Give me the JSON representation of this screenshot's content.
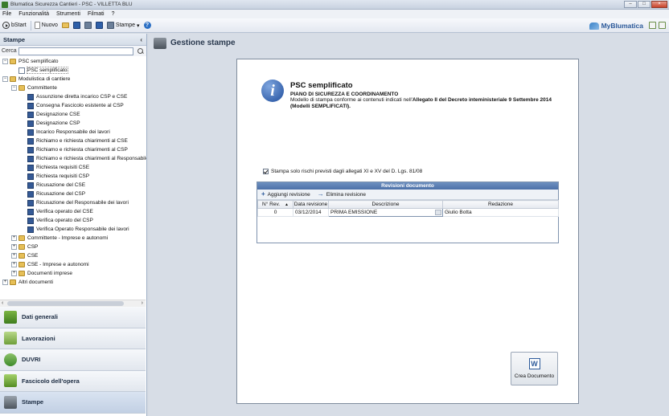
{
  "window": {
    "title": "Blumatica Sicurezza Cantieri - PSC - VILLETTA BLU",
    "minimize": "–",
    "maximize": "□",
    "close": "×"
  },
  "menu": [
    "File",
    "Funzionalità",
    "Strumenti",
    "Filmati",
    "?"
  ],
  "toolbar": {
    "start_label": "bStart",
    "new_label": "Nuovo",
    "print_label": "Stampe",
    "print_arrow": "▾",
    "help_glyph": "?",
    "brand": "MyBlumatica"
  },
  "left_panel": {
    "title": "Stampe",
    "collapse_glyph": "‹",
    "search_label": "Cerca",
    "search_value": "",
    "tree": [
      {
        "label": "PSC semplificato",
        "level": 0,
        "exp": "−",
        "icon": "folder"
      },
      {
        "label": "PSC semplificato",
        "level": 1,
        "exp": "",
        "icon": "psc",
        "selected": true
      },
      {
        "label": "Modulistica di cantiere",
        "level": 0,
        "exp": "−",
        "icon": "folder"
      },
      {
        "label": "Committente",
        "level": 1,
        "exp": "−",
        "icon": "folder"
      },
      {
        "label": "Assunzione diretta incarico CSP e CSE",
        "level": 2,
        "exp": "",
        "icon": "file"
      },
      {
        "label": "Consegna Fascicolo esistente al CSP",
        "level": 2,
        "exp": "",
        "icon": "file"
      },
      {
        "label": "Designazione CSE",
        "level": 2,
        "exp": "",
        "icon": "file"
      },
      {
        "label": "Designazione CSP",
        "level": 2,
        "exp": "",
        "icon": "file"
      },
      {
        "label": "Incarico Responsabile dei lavori",
        "level": 2,
        "exp": "",
        "icon": "file"
      },
      {
        "label": "Richiamo e richiesta chiarimenti al CSE",
        "level": 2,
        "exp": "",
        "icon": "file"
      },
      {
        "label": "Richiamo e richiesta chiarimenti al CSP",
        "level": 2,
        "exp": "",
        "icon": "file"
      },
      {
        "label": "Richiamo e richiesta chiarimenti al Responsabile d",
        "level": 2,
        "exp": "",
        "icon": "file"
      },
      {
        "label": "Richiesta requisiti CSE",
        "level": 2,
        "exp": "",
        "icon": "file"
      },
      {
        "label": "Richiesta requisiti CSP",
        "level": 2,
        "exp": "",
        "icon": "file"
      },
      {
        "label": "Ricusazione del CSE",
        "level": 2,
        "exp": "",
        "icon": "file"
      },
      {
        "label": "Ricusazione del CSP",
        "level": 2,
        "exp": "",
        "icon": "file"
      },
      {
        "label": "Ricusazione del Responsabile dei lavori",
        "level": 2,
        "exp": "",
        "icon": "file"
      },
      {
        "label": "Verifica operato del CSE",
        "level": 2,
        "exp": "",
        "icon": "file"
      },
      {
        "label": "Verifica operato del CSP",
        "level": 2,
        "exp": "",
        "icon": "file"
      },
      {
        "label": "Verifica Operato Responsabile dei lavori",
        "level": 2,
        "exp": "",
        "icon": "file"
      },
      {
        "label": "Committente - Imprese e autonomi",
        "level": 1,
        "exp": "+",
        "icon": "folder"
      },
      {
        "label": "CSP",
        "level": 1,
        "exp": "+",
        "icon": "folder"
      },
      {
        "label": "CSE",
        "level": 1,
        "exp": "+",
        "icon": "folder"
      },
      {
        "label": "CSE - Imprese e autonomi",
        "level": 1,
        "exp": "+",
        "icon": "folder"
      },
      {
        "label": "Documenti imprese",
        "level": 1,
        "exp": "+",
        "icon": "folder"
      },
      {
        "label": "Altri documenti",
        "level": 0,
        "exp": "+",
        "icon": "folder"
      }
    ],
    "scroll_left": "‹",
    "scroll_right": "›",
    "sections": [
      {
        "label": "Dati generali",
        "icon": "dati",
        "name": "dati-generali"
      },
      {
        "label": "Lavorazioni",
        "icon": "lav",
        "name": "lavorazioni"
      },
      {
        "label": "DUVRI",
        "icon": "duvri",
        "name": "duvri"
      },
      {
        "label": "Fascicolo dell'opera",
        "icon": "fasc",
        "name": "fascicolo-opera"
      },
      {
        "label": "Stampe",
        "icon": "stampe",
        "name": "stampe",
        "active": true
      }
    ]
  },
  "main": {
    "title": "Gestione stampe",
    "card": {
      "info_glyph": "i",
      "title": "PSC semplificato",
      "subtitle": "PIANO DI SICUREZZA E COORDINAMENTO",
      "desc_prefix": "Modello di stampa conforme ai contenuti indicati nell'",
      "desc_bold": "Allegato II del Decreto inteministeriale 9 Settembre 2014 (Modelli SEMPLIFICATI).",
      "checkbox_label": "Stampa solo rischi previsti  dagli allegati XI e XV del D. Lgs. 81/08",
      "checkbox_checked": true,
      "revisions": {
        "title": "Revisioni documento",
        "add_label": "Aggiungi revisione",
        "add_glyph": "+",
        "remove_label": "Elimina revisione",
        "remove_glyph": "→",
        "columns": [
          "N° Rev.",
          "Data revisione",
          "Descrizione",
          "Redazione"
        ],
        "sort_glyph": "▲",
        "rows": [
          {
            "rev": "0",
            "date": "03/12/2014",
            "desc": "PRIMA EMISSIONE",
            "author": "Giulio Botta"
          }
        ]
      },
      "create_button": "Crea Documento",
      "create_glyph": "W"
    }
  }
}
